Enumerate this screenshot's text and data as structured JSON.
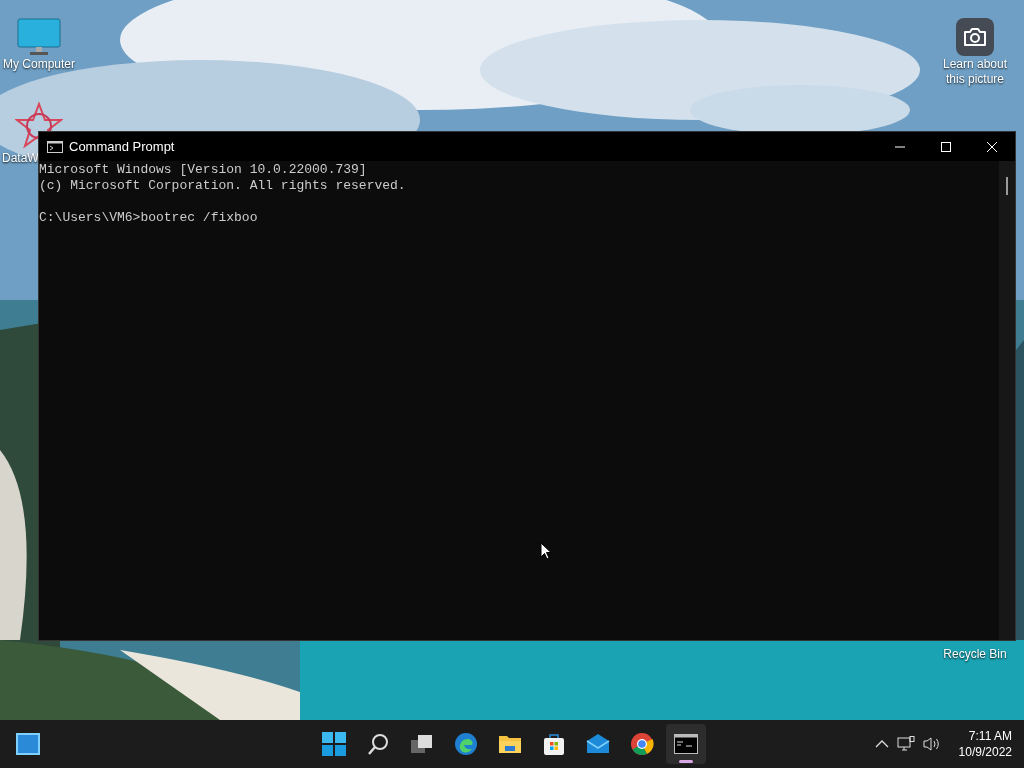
{
  "desktop_icons": [
    {
      "kind": "computer",
      "label": "My Computer"
    },
    {
      "kind": "shortcut",
      "label": "DataW"
    },
    {
      "kind": "camera",
      "label": "Learn about this picture"
    },
    {
      "kind": "recycle",
      "label": "Recycle Bin"
    }
  ],
  "window": {
    "title": "Command Prompt",
    "blocks": [
      [
        "Microsoft Windows [Version 10.0.22000.739]",
        "(c) Microsoft Corporation. All rights reserved."
      ],
      [
        "C:\\Users\\VM6>bootrec /fixboo"
      ]
    ]
  },
  "taskbar": {
    "apps": [
      {
        "kind": "start",
        "selected": false
      },
      {
        "kind": "search",
        "selected": false
      },
      {
        "kind": "taskview",
        "selected": false
      },
      {
        "kind": "edge",
        "selected": false
      },
      {
        "kind": "explorer",
        "selected": false
      },
      {
        "kind": "store",
        "selected": false
      },
      {
        "kind": "mail",
        "selected": false
      },
      {
        "kind": "chrome",
        "selected": false
      },
      {
        "kind": "terminal",
        "selected": true
      }
    ],
    "time": "7:11 AM",
    "date": "10/9/2022"
  }
}
